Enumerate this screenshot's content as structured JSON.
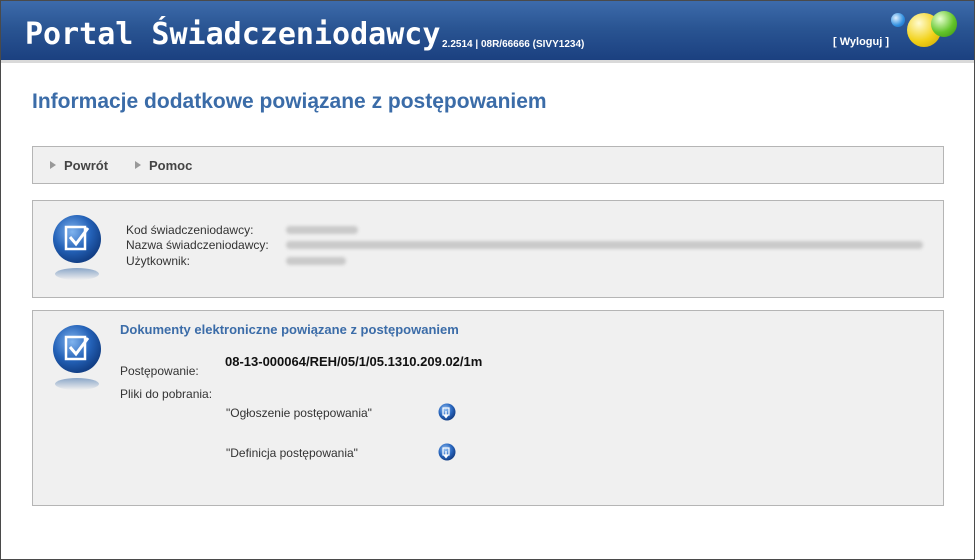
{
  "header": {
    "title": "Portal Świadczeniodawcy",
    "version": "2.2514 | 08R/66666 (SIVY1234)",
    "logout_label": "[ Wyloguj ]"
  },
  "page_title": "Informacje dodatkowe powiązane z postępowaniem",
  "nav": {
    "back_label": "Powrót",
    "help_label": "Pomoc"
  },
  "info": {
    "code_label": "Kod świadczeniodawcy:",
    "name_label": "Nazwa świadczeniodawcy:",
    "user_label": "Użytkownik:"
  },
  "documents": {
    "section_title": "Dokumenty elektroniczne powiązane z postępowaniem",
    "procedure_label": "Postępowanie:",
    "procedure_value": "08-13-000064/REH/05/1/05.1310.209.02/1m",
    "files_label": "Pliki do pobrania:",
    "files": [
      {
        "name": "\"Ogłoszenie postępowania\"",
        "icon": "download-icon"
      },
      {
        "name": "\"Definicja postępowania\"",
        "icon": "download-icon"
      }
    ]
  },
  "colors": {
    "header_blue": "#2a5593",
    "title_blue": "#3b6ca8",
    "panel_bg": "#f0f0f0"
  }
}
